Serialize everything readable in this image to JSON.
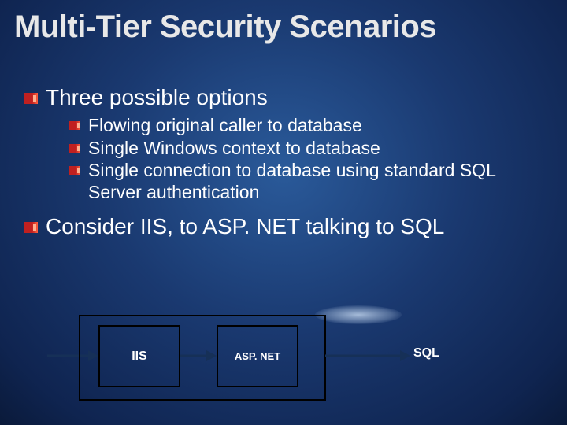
{
  "title": "Multi-Tier Security Scenarios",
  "points": {
    "p1": "Three possible options",
    "p1a": "Flowing original caller to database",
    "p1b": "Single Windows context to database",
    "p1c": "Single connection to database using standard SQL Server authentication",
    "p2": "Consider IIS, to ASP. NET talking to SQL"
  },
  "diagram": {
    "box1": "IIS",
    "box2": "ASP. NET",
    "label": "SQL"
  },
  "colors": {
    "bullet": "#c02020",
    "arrow": "#1a3a6a"
  }
}
